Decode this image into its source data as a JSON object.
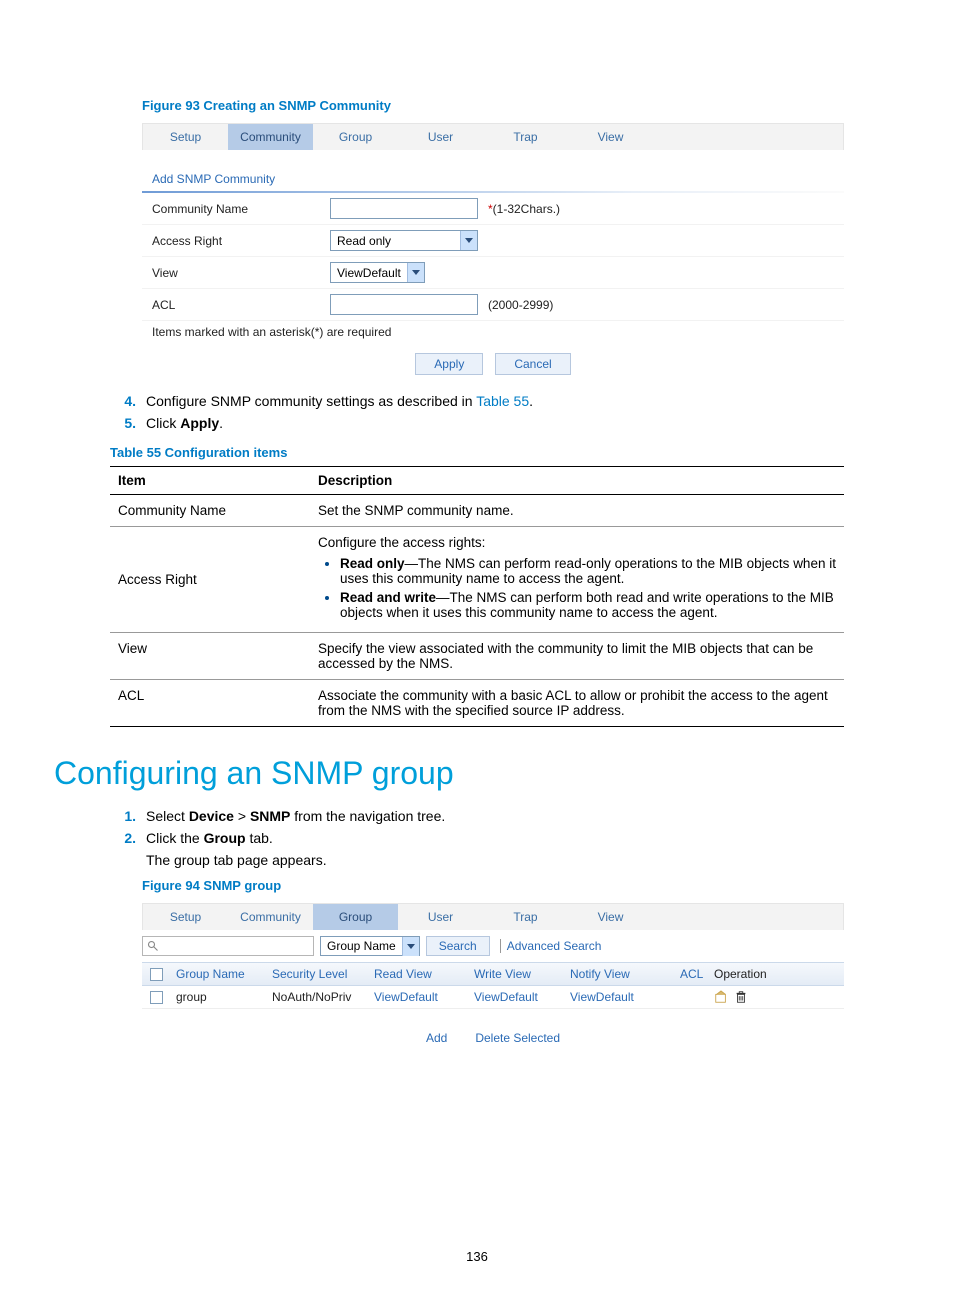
{
  "figure93_caption": "Figure 93 Creating an SNMP Community",
  "fig93_tabs": [
    "Setup",
    "Community",
    "Group",
    "User",
    "Trap",
    "View"
  ],
  "fig93_active_tab": "Community",
  "fig93_form_title": "Add SNMP Community",
  "fig93_rows": {
    "community_name": {
      "label": "Community Name",
      "hint_prefix": "*",
      "hint": "(1-32Chars.)"
    },
    "access_right": {
      "label": "Access Right",
      "value": "Read only"
    },
    "view": {
      "label": "View",
      "value": "ViewDefault"
    },
    "acl": {
      "label": "ACL",
      "hint": "(2000-2999)"
    }
  },
  "fig93_required_note": "Items marked with an asterisk(*) are required",
  "fig93_buttons": {
    "apply": "Apply",
    "cancel": "Cancel"
  },
  "step4": {
    "num": "4.",
    "pre": "Configure SNMP community settings as described in ",
    "link": "Table 55",
    "post": "."
  },
  "step5": {
    "num": "5.",
    "pre": "Click ",
    "bold": "Apply",
    "post": "."
  },
  "table55_caption": "Table 55 Configuration items",
  "table55": {
    "headers": [
      "Item",
      "Description"
    ],
    "rows": [
      {
        "item": "Community Name",
        "desc": "Set the SNMP community name."
      },
      {
        "item": "Access Right",
        "lead": "Configure the access rights:",
        "bullets": [
          {
            "bold": "Read only",
            "rest": "—The NMS can perform read-only operations to the MIB objects when it uses this community name to access the agent."
          },
          {
            "bold": "Read and write",
            "rest": "—The NMS can perform both read and write operations to the MIB objects when it uses this community name to access the agent."
          }
        ]
      },
      {
        "item": "View",
        "desc": "Specify the view associated with the community to limit the MIB objects that can be accessed by the NMS."
      },
      {
        "item": "ACL",
        "desc": "Associate the community with a basic ACL to allow or prohibit the access to the agent from the NMS with the specified source IP address."
      }
    ]
  },
  "section_heading": "Configuring an SNMP group",
  "group_step1": {
    "num": "1.",
    "pre": "Select ",
    "bold1": "Device",
    "gt": " > ",
    "bold2": "SNMP",
    "post": " from the navigation tree."
  },
  "group_step2": {
    "num": "2.",
    "pre": "Click the ",
    "bold": "Group",
    "post": " tab."
  },
  "group_step2_sub": "The group tab page appears.",
  "figure94_caption": "Figure 94 SNMP group",
  "fig94_tabs": [
    "Setup",
    "Community",
    "Group",
    "User",
    "Trap",
    "View"
  ],
  "fig94_active_tab": "Group",
  "search_select": "Group Name",
  "search_btn": "Search",
  "adv_search": "Advanced Search",
  "grid_headers": [
    "Group Name",
    "Security Level",
    "Read View",
    "Write View",
    "Notify View",
    "ACL",
    "Operation"
  ],
  "grid_row": {
    "group_name": "group",
    "security_level": "NoAuth/NoPriv",
    "read_view": "ViewDefault",
    "write_view": "ViewDefault",
    "notify_view": "ViewDefault",
    "acl": ""
  },
  "bottom_buttons": {
    "add": "Add",
    "del": "Delete Selected"
  },
  "page_number": "136"
}
